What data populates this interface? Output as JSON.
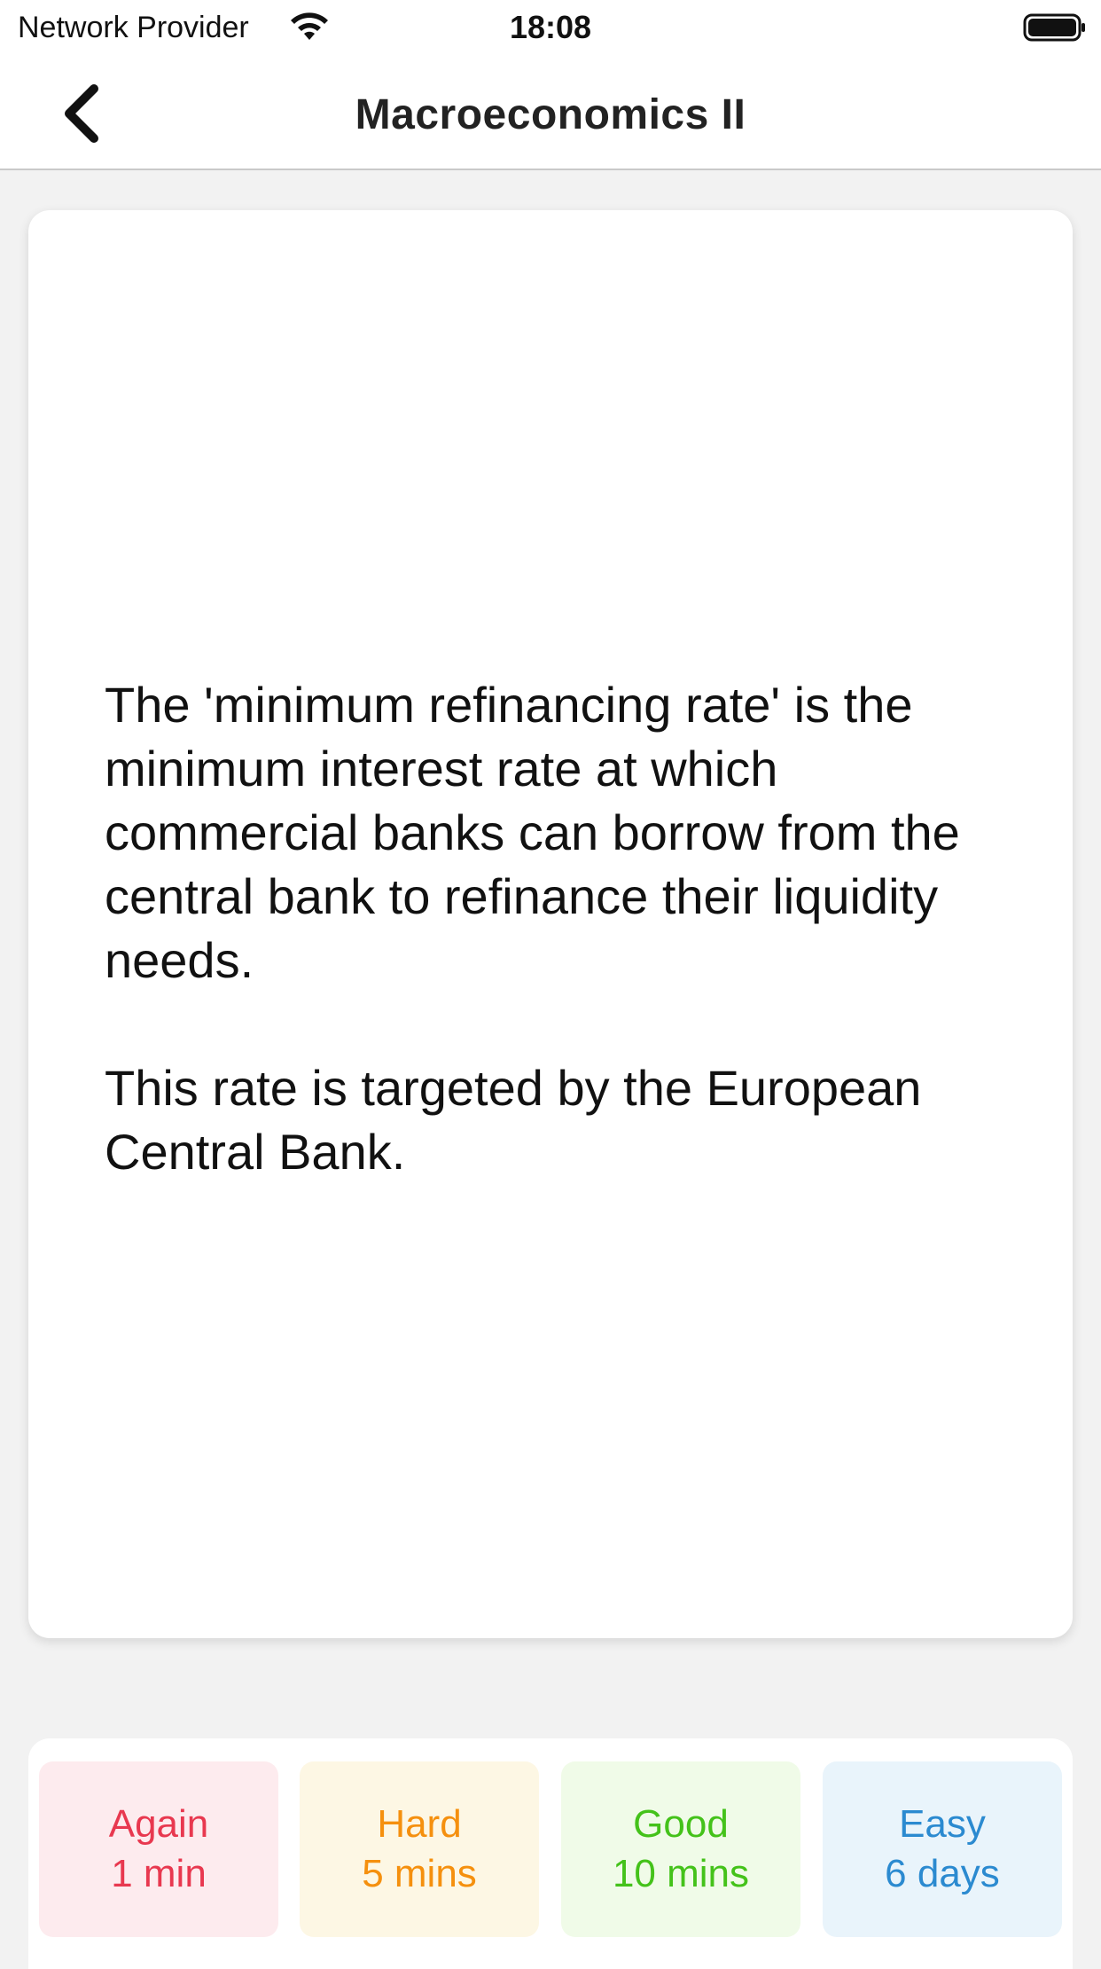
{
  "status_bar": {
    "carrier": "Network Provider",
    "time": "18:08",
    "wifi_icon": "wifi-icon",
    "battery_icon": "battery-icon"
  },
  "nav": {
    "back_icon": "chevron-left-icon",
    "title": "Macroeconomics II"
  },
  "card": {
    "paragraphs": [
      "The 'minimum refinancing rate' is the minimum interest rate at which commercial banks can borrow from the central bank to refinance their liquidity needs.",
      "This rate is targeted by the European Central Bank."
    ]
  },
  "answers": [
    {
      "label": "Again",
      "interval": "1 min",
      "color": "#e8384f",
      "background": "#fdebee"
    },
    {
      "label": "Hard",
      "interval": "5 mins",
      "color": "#f5900e",
      "background": "#fdf7e4"
    },
    {
      "label": "Good",
      "interval": "10 mins",
      "color": "#44c21a",
      "background": "#f0fbe8"
    },
    {
      "label": "Easy",
      "interval": "6 days",
      "color": "#2b8ad0",
      "background": "#e9f4fb"
    }
  ]
}
